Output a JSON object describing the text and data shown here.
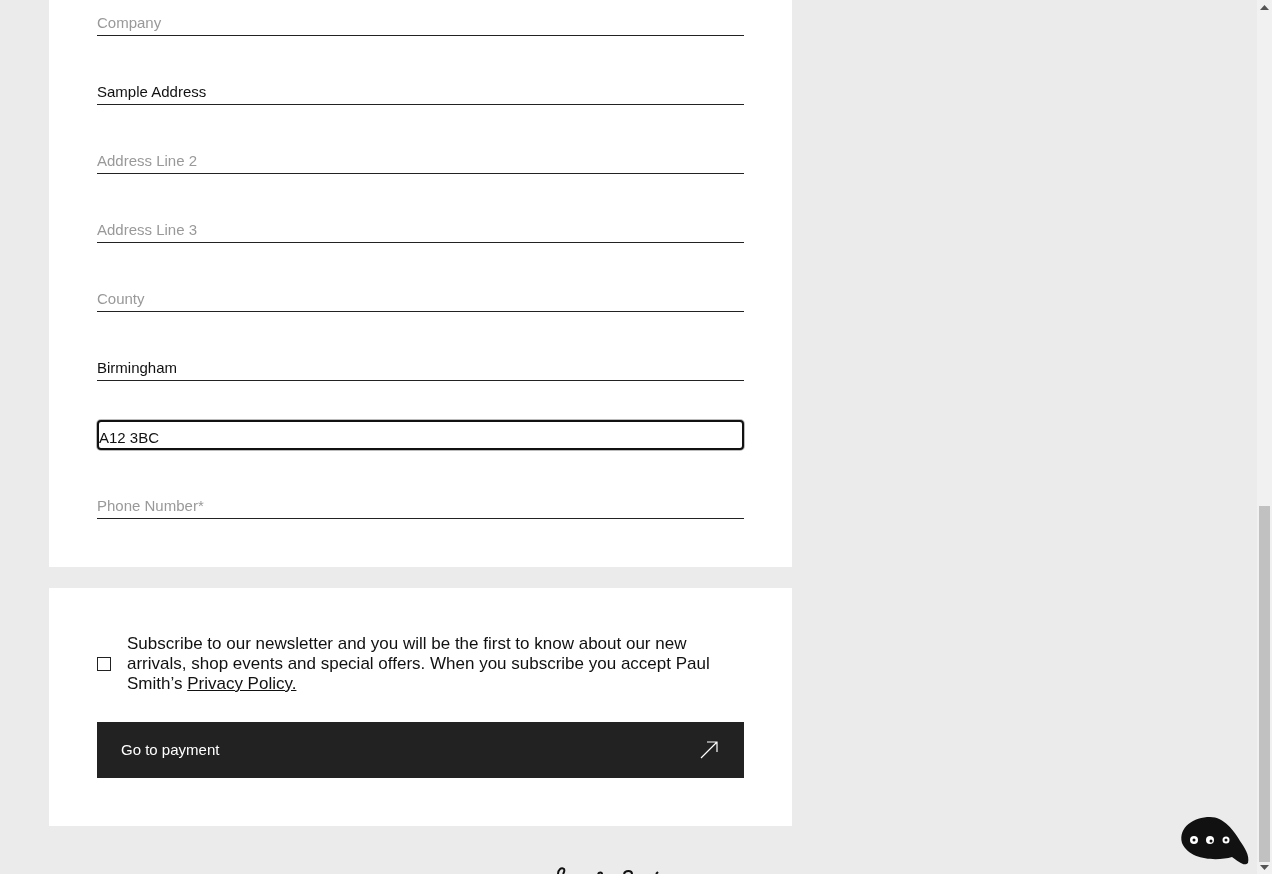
{
  "address_fields": [
    {
      "placeholder": "Company",
      "focused": false
    },
    {
      "value": "Sample Address",
      "focused": false
    },
    {
      "placeholder": "Address Line 2",
      "focused": false
    },
    {
      "placeholder": "Address Line 3",
      "focused": false
    },
    {
      "placeholder": "County",
      "focused": false
    },
    {
      "value": "Birmingham",
      "focused": false
    },
    {
      "value": "A12 3BC",
      "focused": true
    },
    {
      "placeholder": "Phone Number*",
      "focused": false
    }
  ],
  "newsletter": {
    "checked": false,
    "text": "Subscribe to our newsletter and you will be the first to know about our new arrivals, shop events and special offers. When you subscribe you accept Paul Smith’s ",
    "link": "Privacy Policy."
  },
  "payment_button": {
    "label": "Go to payment"
  }
}
